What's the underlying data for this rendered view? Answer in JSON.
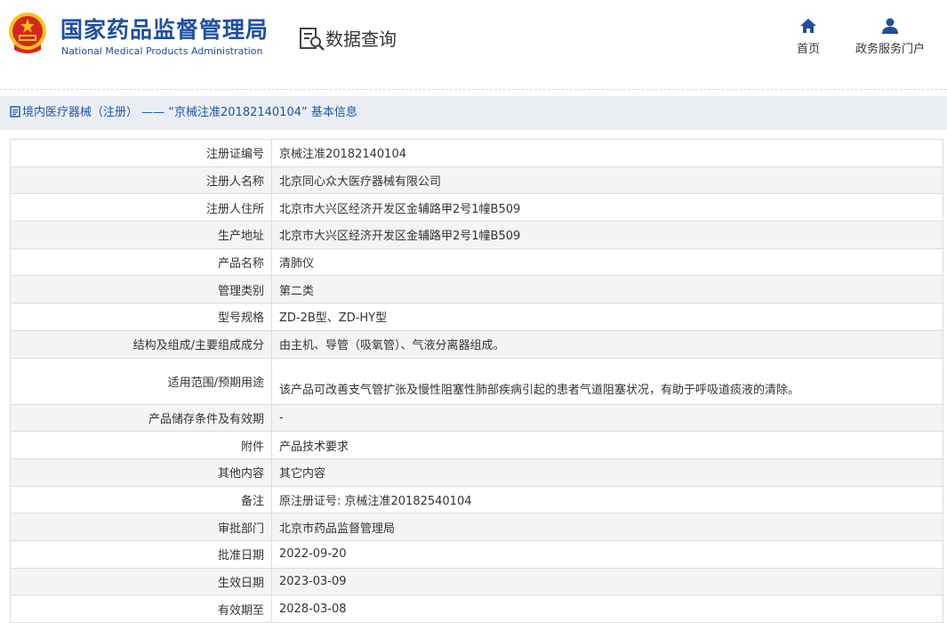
{
  "header": {
    "agency_name_cn": "国家药品监督管理局",
    "agency_name_en": "National Medical Products Administration",
    "section_title": "数据查询",
    "nav": [
      {
        "label": "首页",
        "icon": "home-icon"
      },
      {
        "label": "政务服务门户",
        "icon": "user-icon"
      }
    ]
  },
  "breadcrumb": {
    "text": "境内医疗器械（注册） —— “京械注准20182140104” 基本信息",
    "icon": "document-icon"
  },
  "record": [
    {
      "label": "注册证编号",
      "value": "京械注准20182140104"
    },
    {
      "label": "注册人名称",
      "value": "北京同心众大医疗器械有限公司"
    },
    {
      "label": "注册人住所",
      "value": "北京市大兴区经济开发区金辅路甲2号1幢B509"
    },
    {
      "label": "生产地址",
      "value": "北京市大兴区经济开发区金辅路甲2号1幢B509"
    },
    {
      "label": "产品名称",
      "value": "清肺仪"
    },
    {
      "label": "管理类别",
      "value": "第二类"
    },
    {
      "label": "型号规格",
      "value": "ZD-2B型、ZD-HY型"
    },
    {
      "label": "结构及组成/主要组成成分",
      "value": "由主机、导管（吸氧管）、气液分离器组成。"
    },
    {
      "label": "适用范围/预期用途",
      "value": "该产品可改善支气管扩张及慢性阻塞性肺部疾病引起的患者气道阻塞状况，有助于呼吸道痰液的清除。"
    },
    {
      "label": "产品储存条件及有效期",
      "value": "-"
    },
    {
      "label": "附件",
      "value": "产品技术要求"
    },
    {
      "label": "其他内容",
      "value": "其它内容"
    },
    {
      "label": "备注",
      "value": "原注册证号: 京械注准20182540104"
    },
    {
      "label": "审批部门",
      "value": "北京市药品监督管理局"
    },
    {
      "label": "批准日期",
      "value": "2022-09-20"
    },
    {
      "label": "生效日期",
      "value": "2023-03-09"
    },
    {
      "label": "有效期至",
      "value": "2028-03-08"
    }
  ],
  "colors": {
    "brand_blue": "#1f4fa0",
    "link_blue": "#1a56a8",
    "breadcrumb_bg": "#eaeef3",
    "emblem_red": "#d7261e",
    "emblem_gold": "#f5c518"
  }
}
